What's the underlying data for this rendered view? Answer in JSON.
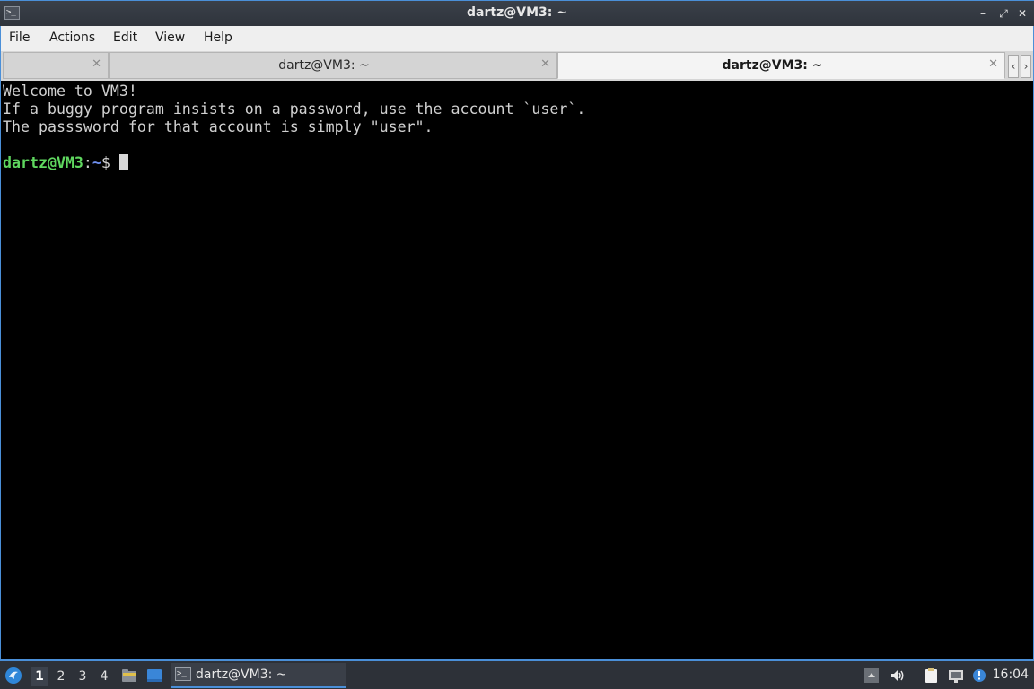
{
  "window": {
    "title": "dartz@VM3: ~",
    "buttons": {
      "minimize": "–",
      "maximize": "⤢",
      "close": "✕"
    }
  },
  "menu": {
    "file": "File",
    "actions": "Actions",
    "edit": "Edit",
    "view": "View",
    "help": "Help"
  },
  "tabs": [
    {
      "label": "",
      "active": false
    },
    {
      "label": "dartz@VM3: ~",
      "active": false
    },
    {
      "label": "dartz@VM3: ~",
      "active": true
    }
  ],
  "tab_close_glyph": "✕",
  "tab_scroll": {
    "left": "‹",
    "right": "›"
  },
  "terminal": {
    "lines": [
      "Welcome to VM3!",
      "If a buggy program insists on a password, use the account `user`.",
      "The passsword for that account is simply \"user\"."
    ],
    "prompt": {
      "user_host": "dartz@VM3",
      "colon": ":",
      "path": "~",
      "dollar": "$"
    }
  },
  "taskbar": {
    "workspaces": [
      "1",
      "2",
      "3",
      "4"
    ],
    "active_workspace": "1",
    "task_label": "dartz@VM3: ~",
    "clock": "16:04",
    "icons": {
      "start": "lxqt-menu-icon",
      "file_manager": "file-manager-icon",
      "show_desktop": "show-desktop-icon",
      "terminal": "terminal-icon",
      "tray_arrow": "tray-expand-icon",
      "volume": "volume-icon",
      "clipboard": "clipboard-icon",
      "network": "network-icon",
      "updates": "update-notifier-icon"
    }
  },
  "colors": {
    "accent": "#4a8fd8",
    "prompt_user": "#5fd75f",
    "prompt_path": "#6f8fef",
    "terminal_bg": "#000000",
    "terminal_fg": "#d0d0d0"
  }
}
